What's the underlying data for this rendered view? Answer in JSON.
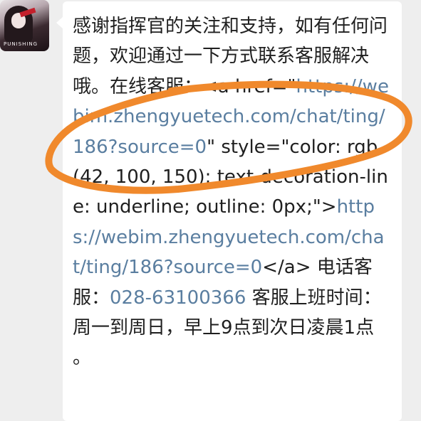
{
  "avatar": {
    "logo_text": "PUNISHING"
  },
  "message": {
    "segments": [
      {
        "type": "text",
        "text": "感谢指挥官的关注和支持，如有任何问题，欢迎通过一下方式联系客服解决哦。在线客服：<a href=\""
      },
      {
        "type": "link",
        "text": "https://webim.zhengyuetech.com/chat/ting/186?source=0"
      },
      {
        "type": "text",
        "text": "\" style=\"color: rgb(42, 100, 150); text-decoration-line: underline; outline: 0px;\">"
      },
      {
        "type": "link",
        "text": "https://webim.zhengyuetech.com/chat/ting/186?source=0"
      },
      {
        "type": "text",
        "text": "</a> 电话客服："
      },
      {
        "type": "link",
        "text": "028-63100366"
      },
      {
        "type": "text",
        "text": " 客服上班时间： 周一到周日，早上9点到次日凌晨1点 。"
      }
    ]
  },
  "colors": {
    "background": "#eeeeee",
    "bubble": "#ffffff",
    "text": "#1f1f1f",
    "link": "#5a7ea0",
    "annotation_circle": "#f0892c"
  }
}
